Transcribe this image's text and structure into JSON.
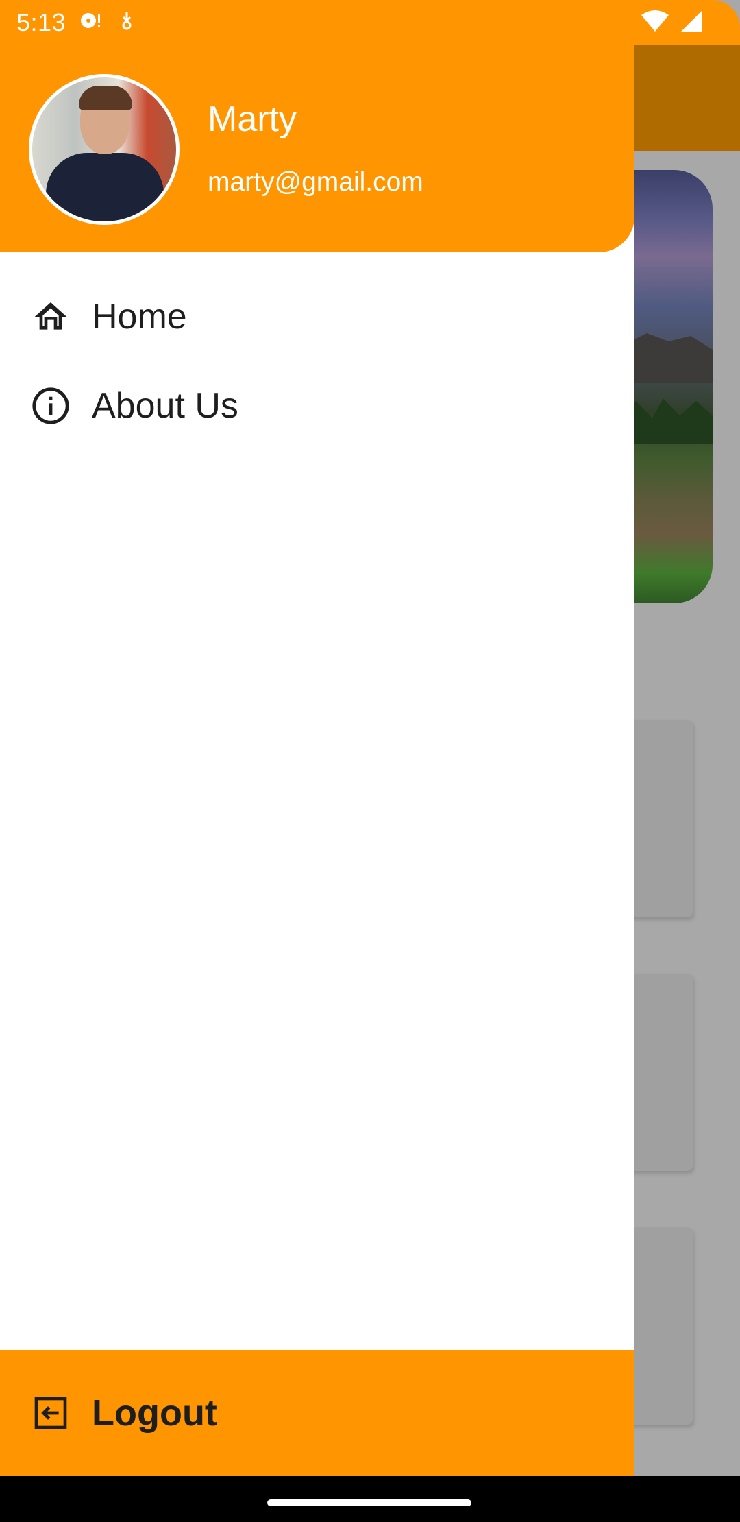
{
  "status_bar": {
    "time": "5:13",
    "icons": [
      "media-notification-icon",
      "download-notification-icon",
      "wifi-icon",
      "cell-signal-icon"
    ]
  },
  "drawer": {
    "header": {
      "user_name": "Marty",
      "user_email": "marty@gmail.com",
      "background_color": "#ff9500"
    },
    "items": [
      {
        "label": "Home",
        "icon": "home-icon"
      },
      {
        "label": "About Us",
        "icon": "info-icon"
      }
    ],
    "footer": {
      "label": "Logout",
      "icon": "logout-icon"
    }
  },
  "colors": {
    "accent": "#ff9500",
    "text": "#1e1e1e"
  }
}
